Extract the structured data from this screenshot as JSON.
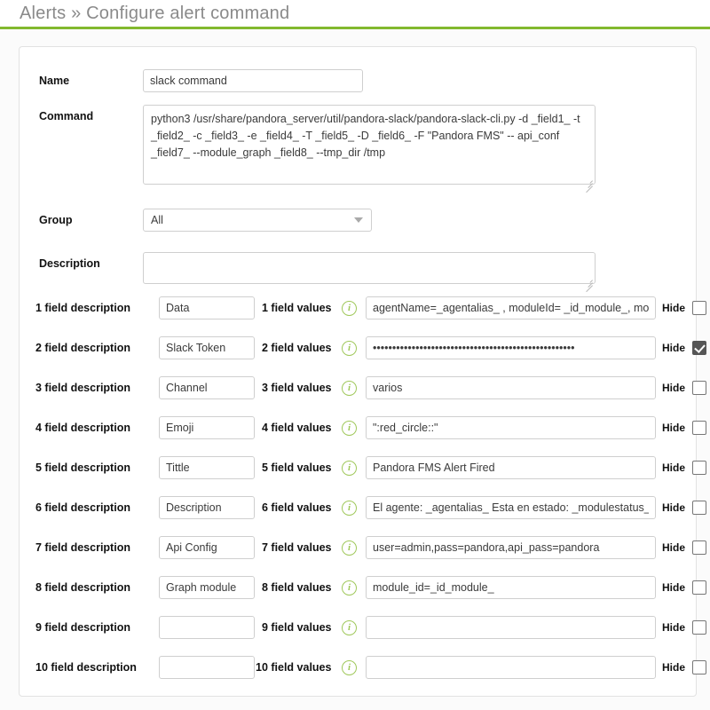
{
  "header": {
    "breadcrumb_section": "Alerts",
    "separator": "»",
    "title": "Alerts » Configure alert command",
    "page_title": "Configure alert command",
    "accent_color": "#82b92e"
  },
  "form": {
    "name": {
      "label": "Name",
      "value": "slack command"
    },
    "command": {
      "label": "Command",
      "value": "python3 /usr/share/pandora_server/util/pandora-slack/pandora-slack-cli.py -d _field1_ -t _field2_ -c _field3_ -e _field4_ -T _field5_ -D _field6_ -F \"Pandora FMS\" -- api_conf _field7_ --module_graph _field8_ --tmp_dir /tmp"
    },
    "group": {
      "label": "Group",
      "value": "All",
      "options": [
        "All"
      ]
    },
    "description": {
      "label": "Description",
      "value": ""
    },
    "hide_label": "Hide",
    "info_icon_glyph": "i",
    "fields": [
      {
        "index": 1,
        "desc_label": "1 field description",
        "desc_value": "Data",
        "values_label": "1 field values",
        "value": "agentName=_agentalias_ , moduleId= _id_module_, mod",
        "hide_checked": false,
        "masked": false
      },
      {
        "index": 2,
        "desc_label": "2 field description",
        "desc_value": "Slack Token",
        "values_label": "2 field values",
        "value": "••••••••••••••••••••••••••••••••••••••••••••••••••••",
        "hide_checked": true,
        "masked": true
      },
      {
        "index": 3,
        "desc_label": "3 field description",
        "desc_value": "Channel",
        "values_label": "3 field values",
        "value": "varios",
        "hide_checked": false,
        "masked": false
      },
      {
        "index": 4,
        "desc_label": "4 field description",
        "desc_value": "Emoji",
        "values_label": "4 field values",
        "value": "\":red_circle::\"",
        "hide_checked": false,
        "masked": false
      },
      {
        "index": 5,
        "desc_label": "5 field description",
        "desc_value": "Tittle",
        "values_label": "5 field values",
        "value": "Pandora FMS Alert Fired",
        "hide_checked": false,
        "masked": false
      },
      {
        "index": 6,
        "desc_label": "6 field description",
        "desc_value": "Description",
        "values_label": "6 field values",
        "value": "El agente: _agentalias_ Esta en estado: _modulestatus_",
        "hide_checked": false,
        "masked": false
      },
      {
        "index": 7,
        "desc_label": "7 field description",
        "desc_value": "Api Config",
        "values_label": "7 field values",
        "value": "user=admin,pass=pandora,api_pass=pandora",
        "hide_checked": false,
        "masked": false
      },
      {
        "index": 8,
        "desc_label": "8 field description",
        "desc_value": "Graph module",
        "values_label": "8 field values",
        "value": "module_id=_id_module_",
        "hide_checked": false,
        "masked": false
      },
      {
        "index": 9,
        "desc_label": "9 field description",
        "desc_value": "",
        "values_label": "9 field values",
        "value": "",
        "hide_checked": false,
        "masked": false
      },
      {
        "index": 10,
        "desc_label": "10 field description",
        "desc_value": "",
        "values_label": "10 field values",
        "value": "",
        "hide_checked": false,
        "masked": false
      }
    ]
  }
}
